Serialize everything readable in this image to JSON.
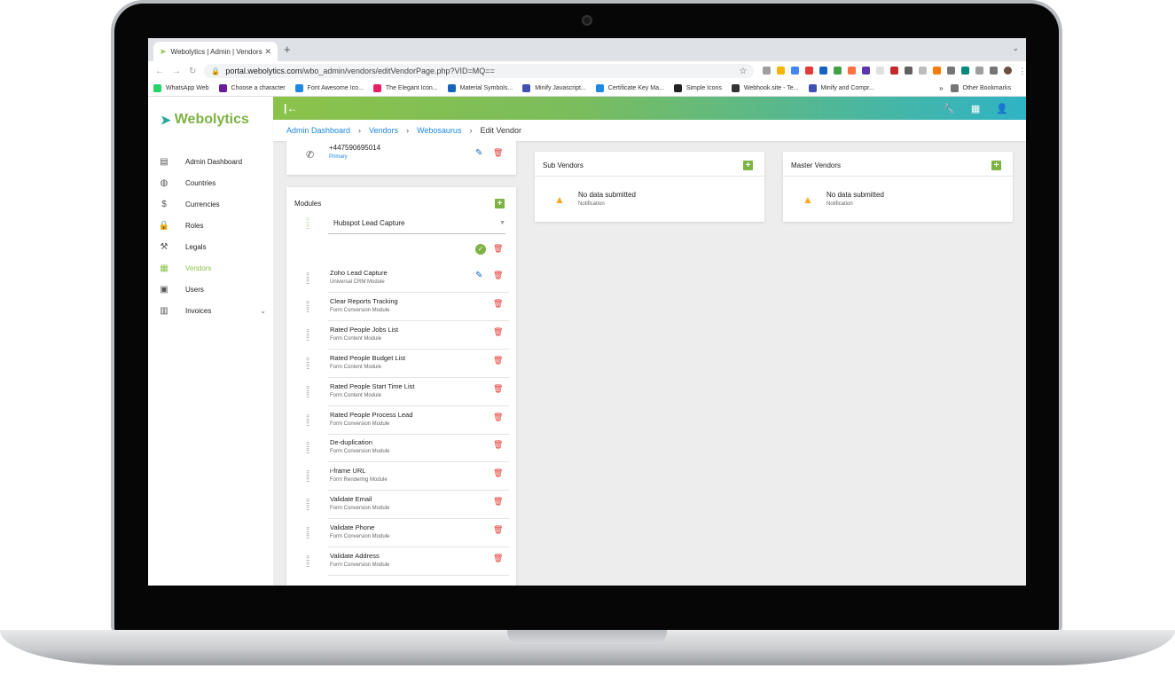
{
  "browser": {
    "tab_title": "Webolytics | Admin | Vendors",
    "url_host": "portal.webolytics.com",
    "url_path": "/wbo_admin/vendors/editVendorPage.php?VID=MQ==",
    "bookmarks": [
      {
        "label": "WhatsApp Web",
        "color": "#25d366"
      },
      {
        "label": "Choose a character",
        "color": "#6a1b9a"
      },
      {
        "label": "Font Awesome Ico...",
        "color": "#1e88e5"
      },
      {
        "label": "The Elegant Icon...",
        "color": "#e91e63"
      },
      {
        "label": "Material Symbols...",
        "color": "#1565c0"
      },
      {
        "label": "Minify Javascript...",
        "color": "#3f51b5"
      },
      {
        "label": "Certificate Key Ma...",
        "color": "#1e88e5"
      },
      {
        "label": "Simple Icons",
        "color": "#222222"
      },
      {
        "label": "Webhook.site - Te...",
        "color": "#333333"
      },
      {
        "label": "Minify and Compr...",
        "color": "#3f51b5"
      }
    ],
    "bookmarks_more": "»",
    "other_bookmarks": "Other Bookmarks"
  },
  "brand": {
    "name": "Webolytics",
    "accent": "#8bc34a",
    "teal": "#2fb3c5"
  },
  "sidebar": {
    "items": [
      {
        "label": "Admin Dashboard",
        "icon": "dashboard-icon"
      },
      {
        "label": "Countries",
        "icon": "globe-icon"
      },
      {
        "label": "Currencies",
        "icon": "dollar-icon"
      },
      {
        "label": "Roles",
        "icon": "lock-icon"
      },
      {
        "label": "Legals",
        "icon": "gavel-icon"
      },
      {
        "label": "Vendors",
        "icon": "vendors-icon",
        "active": true
      },
      {
        "label": "Users",
        "icon": "users-icon"
      },
      {
        "label": "Invoices",
        "icon": "wallet-icon"
      }
    ]
  },
  "breadcrumb": {
    "items": [
      "Admin Dashboard",
      "Vendors",
      "Webosaurus"
    ],
    "current": "Edit Vendor"
  },
  "phone": {
    "number": "+447590695014",
    "label": "Primary"
  },
  "modules": {
    "title": "Modules",
    "selected": "Hubspot Lead Capture",
    "rows": [
      {
        "name": "Zoho Lead Capture",
        "type": "Universal CRM Module",
        "editable": true
      },
      {
        "name": "Clear Reports Tracking",
        "type": "Form Conversion Module"
      },
      {
        "name": "Rated People Jobs List",
        "type": "Form Content Module"
      },
      {
        "name": "Rated People Budget List",
        "type": "Form Content Module"
      },
      {
        "name": "Rated People Start Time List",
        "type": "Form Content Module"
      },
      {
        "name": "Rated People Process Lead",
        "type": "Form Conversion Module"
      },
      {
        "name": "De-duplication",
        "type": "Form Conversion Module"
      },
      {
        "name": "i-frame URL",
        "type": "Form Rendering Module"
      },
      {
        "name": "Validate Email",
        "type": "Form Conversion Module"
      },
      {
        "name": "Validate Phone",
        "type": "Form Conversion Module"
      },
      {
        "name": "Validate Address",
        "type": "Form Conversion Module"
      }
    ]
  },
  "sub_vendors": {
    "title": "Sub Vendors",
    "empty_title": "No data submitted",
    "empty_sub": "Notification"
  },
  "master_vendors": {
    "title": "Master Vendors",
    "empty_title": "No data submitted",
    "empty_sub": "Notification"
  }
}
